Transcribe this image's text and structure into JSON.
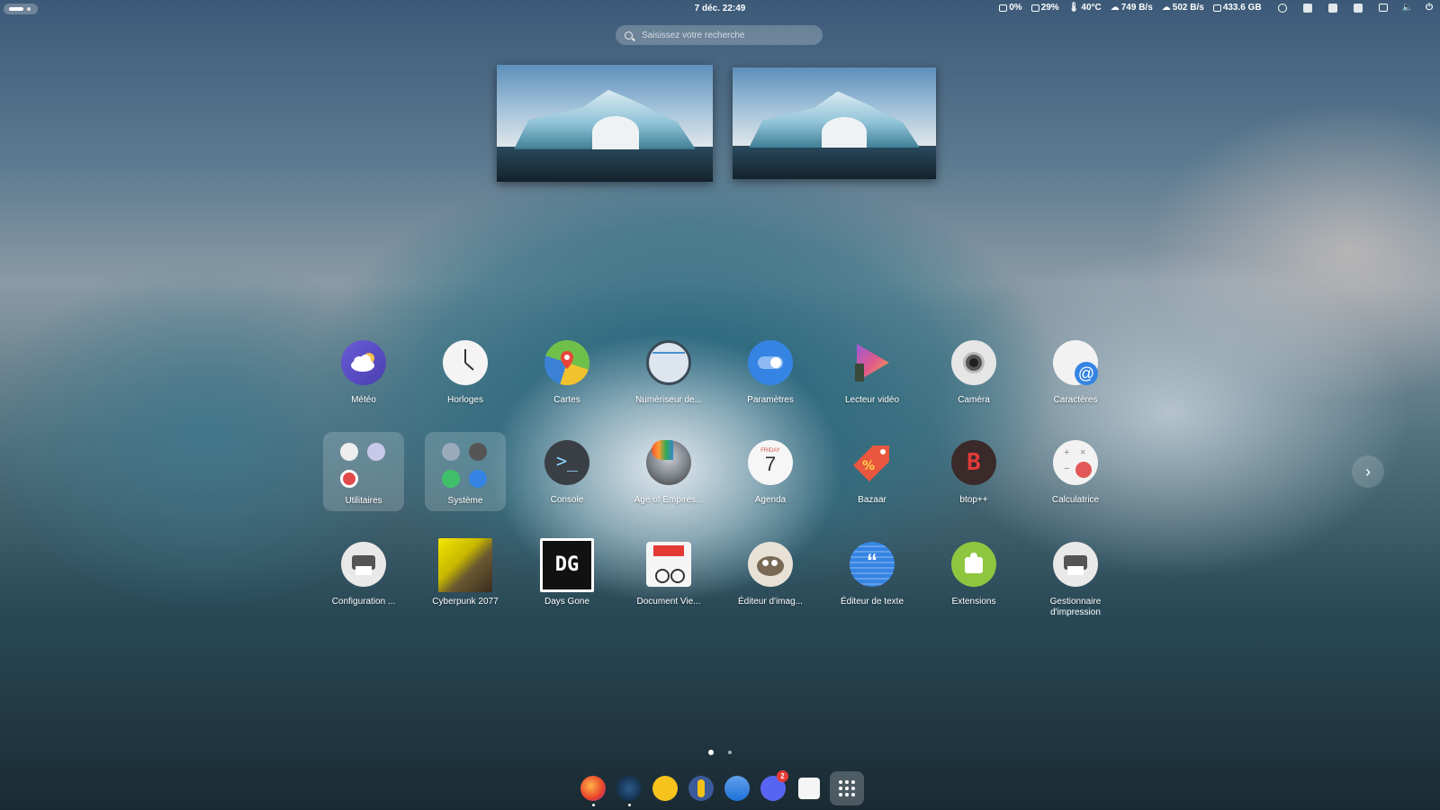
{
  "topbar": {
    "clock": "7 déc.  22:49",
    "cpu": "0%",
    "mem": "29%",
    "temp": "40°C",
    "down": "749 B/s",
    "up": "502 B/s",
    "disk": "433.6 GB"
  },
  "search": {
    "placeholder": "Saisissez votre recherche"
  },
  "apps": {
    "meteo": "Météo",
    "horloges": "Horloges",
    "cartes": "Cartes",
    "numeriseur": "Numériseur de...",
    "parametres": "Paramètres",
    "lecteur": "Lecteur vidéo",
    "camera": "Caméra",
    "caracteres": "Caractères",
    "utilitaires": "Utilitaires",
    "systeme": "Système",
    "console": "Console",
    "aoe": "Age of Empires...",
    "agenda": "Agenda",
    "agenda_day": "FRIDAY",
    "agenda_date": "7",
    "bazaar": "Bazaar",
    "btop": "btop++",
    "calculatrice": "Calculatrice",
    "config": "Configuration ...",
    "cyberpunk": "Cyberpunk 2077",
    "daysgone": "Days Gone",
    "daysgone_logo": "DG",
    "docviewer": "Document Vie...",
    "imageeditor": "Éditeur d'imag...",
    "texteditor": "Éditeur de texte",
    "extensions": "Extensions",
    "printmgr_line1": "Gestionnaire",
    "printmgr_line2": "d'impression"
  },
  "dock": {
    "discord_badge": "2"
  },
  "colors": {
    "accent": "#3584e4",
    "folder": "rgba(255,255,255,0.18)"
  }
}
